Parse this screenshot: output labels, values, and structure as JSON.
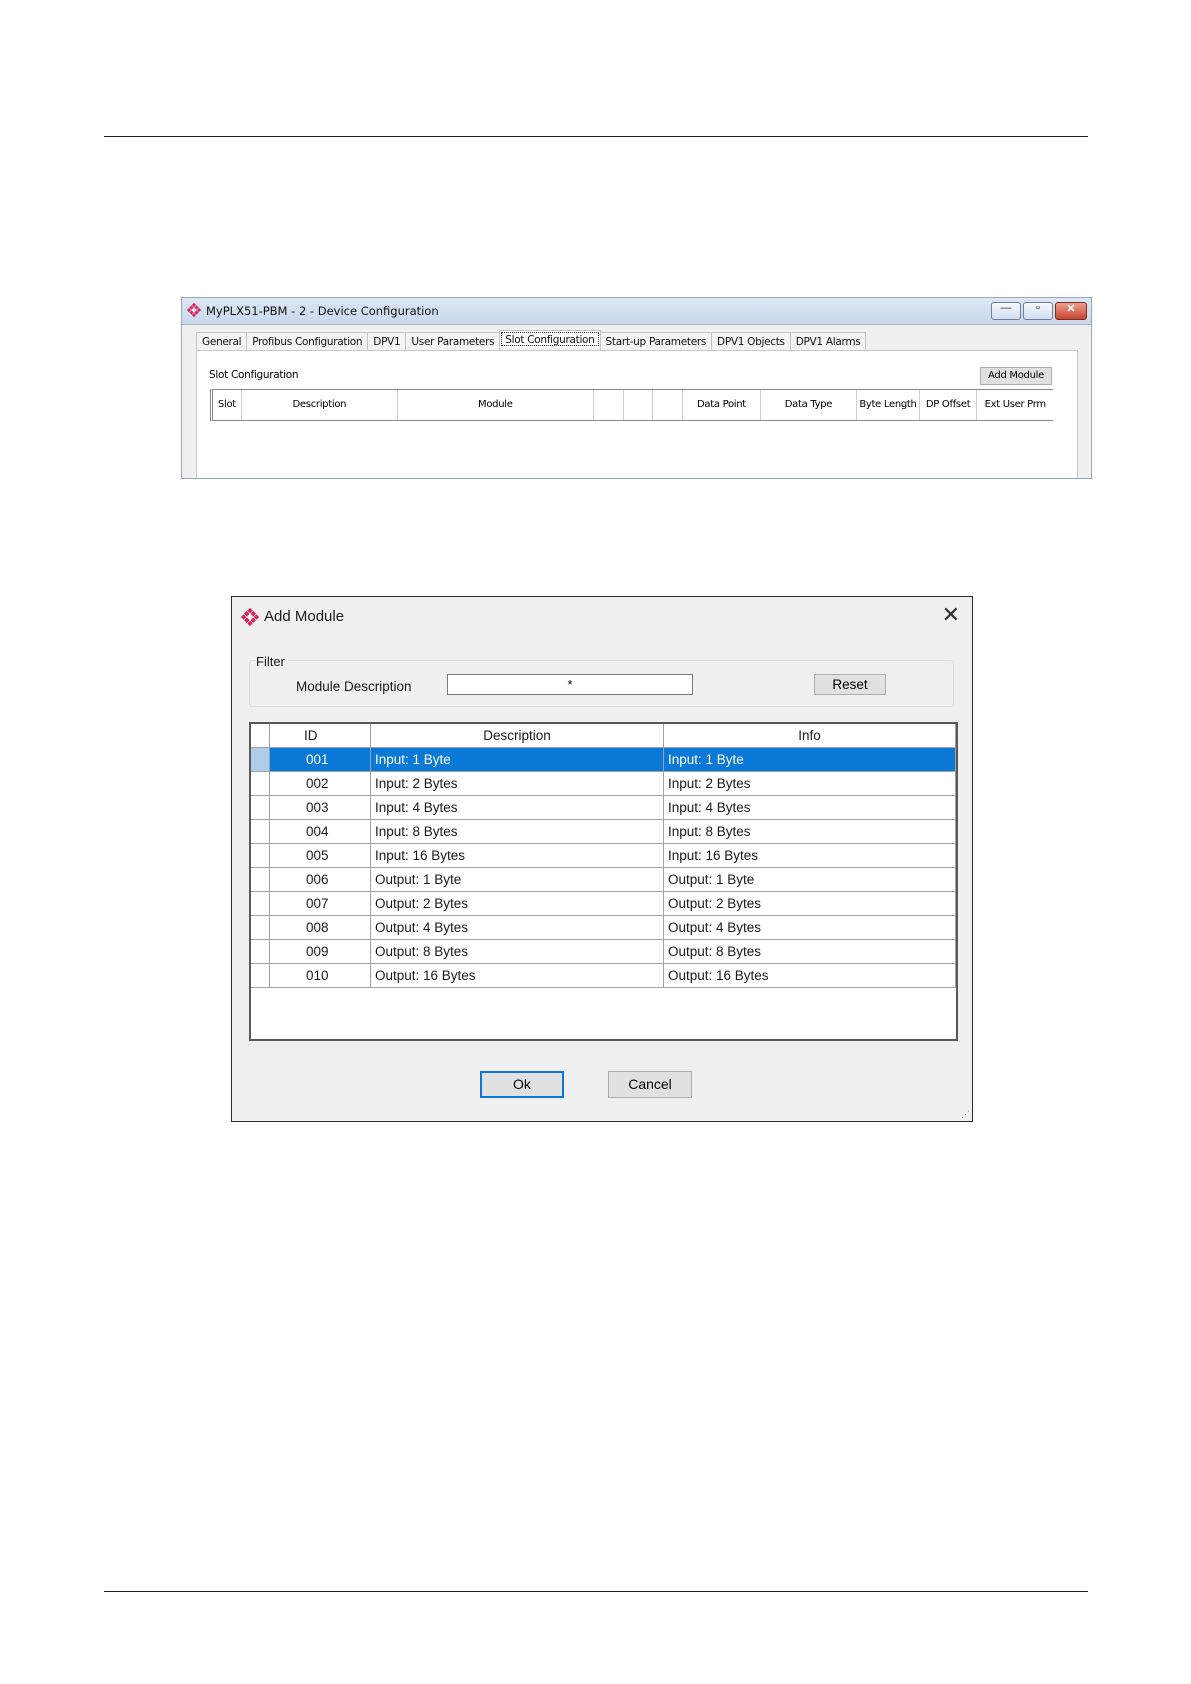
{
  "device_window": {
    "title": "MyPLX51-PBM - 2 - Device Configuration",
    "caption_buttons": {
      "minimize": "—",
      "maximize": "▫",
      "close": "✕"
    },
    "tabs": [
      "General",
      "Profibus Configuration",
      "DPV1",
      "User Parameters",
      "Slot Configuration",
      "Start-up Parameters",
      "DPV1 Objects",
      "DPV1 Alarms"
    ],
    "active_tab": "Slot Configuration",
    "panel_label": "Slot Configuration",
    "add_module_label": "Add Module",
    "columns": [
      "Slot",
      "Description",
      "Module",
      "",
      "",
      "",
      "Data Point",
      "Data Type",
      "Byte Length",
      "DP Offset",
      "Ext User Prm"
    ]
  },
  "add_module_dialog": {
    "title": "Add Module",
    "close_glyph": "✕",
    "filter": {
      "legend": "Filter",
      "label": "Module Description",
      "value": "*",
      "reset_label": "Reset"
    },
    "columns": {
      "id": "ID",
      "description": "Description",
      "info": "Info"
    },
    "rows": [
      {
        "id": "001",
        "description": "Input: 1 Byte",
        "info": "Input: 1 Byte"
      },
      {
        "id": "002",
        "description": "Input: 2 Bytes",
        "info": "Input: 2 Bytes"
      },
      {
        "id": "003",
        "description": "Input: 4 Bytes",
        "info": "Input: 4 Bytes"
      },
      {
        "id": "004",
        "description": "Input: 8 Bytes",
        "info": "Input: 8 Bytes"
      },
      {
        "id": "005",
        "description": "Input: 16 Bytes",
        "info": "Input: 16 Bytes"
      },
      {
        "id": "006",
        "description": "Output: 1 Byte",
        "info": "Output: 1 Byte"
      },
      {
        "id": "007",
        "description": "Output: 2 Bytes",
        "info": "Output: 2 Bytes"
      },
      {
        "id": "008",
        "description": "Output: 4 Bytes",
        "info": "Output: 4 Bytes"
      },
      {
        "id": "009",
        "description": "Output: 8 Bytes",
        "info": "Output: 8 Bytes"
      },
      {
        "id": "010",
        "description": "Output: 16 Bytes",
        "info": "Output: 16 Bytes"
      }
    ],
    "selected_row": "001",
    "ok_label": "Ok",
    "cancel_label": "Cancel"
  },
  "colors": {
    "selection": "#0a78d7",
    "logo": "#d8245a"
  }
}
